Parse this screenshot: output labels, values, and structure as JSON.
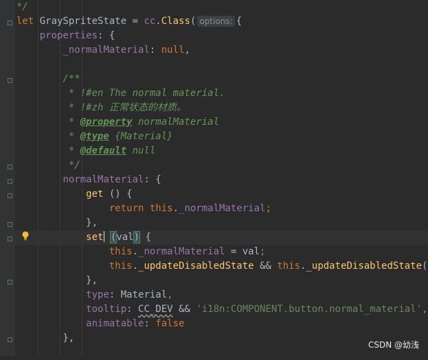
{
  "editor": {
    "lines": [
      {
        "segments": [
          {
            "t": "*/",
            "c": "com"
          }
        ]
      },
      {
        "segments": [
          {
            "t": "let ",
            "c": "kw"
          },
          {
            "t": "GraySpriteState = "
          },
          {
            "t": "cc",
            "c": "prop"
          },
          {
            "t": "."
          },
          {
            "t": "Class",
            "c": "fn"
          },
          {
            "t": "("
          },
          {
            "t": "options:",
            "c": "hint"
          },
          {
            "t": "{"
          }
        ]
      },
      {
        "segments": [
          {
            "t": "    "
          },
          {
            "t": "properties",
            "c": "prop"
          },
          {
            "t": ": {"
          }
        ]
      },
      {
        "segments": [
          {
            "t": "        "
          },
          {
            "t": "_normalMaterial",
            "c": "prop"
          },
          {
            "t": ": "
          },
          {
            "t": "null",
            "c": "kw"
          },
          {
            "t": ","
          }
        ]
      },
      {
        "segments": [
          {
            "t": ""
          }
        ]
      },
      {
        "segments": [
          {
            "t": "        /**",
            "c": "com"
          }
        ]
      },
      {
        "segments": [
          {
            "t": "         * !#en The normal material.",
            "c": "com"
          }
        ]
      },
      {
        "segments": [
          {
            "t": "         * !#zh 正常状态的材质。",
            "c": "com"
          }
        ]
      },
      {
        "segments": [
          {
            "t": "         * ",
            "c": "com"
          },
          {
            "t": "@property",
            "c": "tag"
          },
          {
            "t": " normalMaterial",
            "c": "com"
          }
        ]
      },
      {
        "segments": [
          {
            "t": "         * ",
            "c": "com"
          },
          {
            "t": "@type",
            "c": "tag"
          },
          {
            "t": " {Material}",
            "c": "com"
          }
        ]
      },
      {
        "segments": [
          {
            "t": "         * ",
            "c": "com"
          },
          {
            "t": "@default",
            "c": "tag"
          },
          {
            "t": " null",
            "c": "com"
          }
        ]
      },
      {
        "segments": [
          {
            "t": "         */",
            "c": "com"
          }
        ]
      },
      {
        "segments": [
          {
            "t": "        "
          },
          {
            "t": "normalMaterial",
            "c": "prop"
          },
          {
            "t": ": {"
          }
        ]
      },
      {
        "segments": [
          {
            "t": "            "
          },
          {
            "t": "get",
            "c": "fn"
          },
          {
            "t": " () {"
          }
        ]
      },
      {
        "segments": [
          {
            "t": "                "
          },
          {
            "t": "return this",
            "c": "kw"
          },
          {
            "t": "."
          },
          {
            "t": "_normalMaterial",
            "c": "prop"
          },
          {
            "t": ";",
            "c": "kw"
          }
        ]
      },
      {
        "segments": [
          {
            "t": "            },"
          }
        ]
      },
      {
        "current": true,
        "segments": [
          {
            "t": "            "
          },
          {
            "t": "set",
            "c": "fn"
          },
          {
            "t": "",
            "c": "caret"
          },
          {
            "t": " "
          },
          {
            "t": "(",
            "c": "match"
          },
          {
            "t": "val"
          },
          {
            "t": ")",
            "c": "match"
          },
          {
            "t": " {"
          }
        ]
      },
      {
        "segments": [
          {
            "t": "                "
          },
          {
            "t": "this",
            "c": "kw"
          },
          {
            "t": "."
          },
          {
            "t": "_normalMaterial",
            "c": "prop"
          },
          {
            "t": " = val"
          },
          {
            "t": ";",
            "c": "kw"
          }
        ]
      },
      {
        "segments": [
          {
            "t": "                "
          },
          {
            "t": "this",
            "c": "kw"
          },
          {
            "t": "."
          },
          {
            "t": "_updateDisabledState",
            "c": "fn"
          },
          {
            "t": " && "
          },
          {
            "t": "this",
            "c": "kw"
          },
          {
            "t": "."
          },
          {
            "t": "_updateDisabledState",
            "c": "fn"
          },
          {
            "t": "()"
          },
          {
            "t": ";",
            "c": "kw"
          }
        ]
      },
      {
        "segments": [
          {
            "t": "            },"
          }
        ]
      },
      {
        "segments": [
          {
            "t": "            "
          },
          {
            "t": "type",
            "c": "prop"
          },
          {
            "t": ": Material"
          },
          {
            "t": ",",
            "c": "kw"
          }
        ]
      },
      {
        "segments": [
          {
            "t": "            "
          },
          {
            "t": "tooltip",
            "c": "prop"
          },
          {
            "t": ": "
          },
          {
            "t": "CC_DEV",
            "c": "squiggle"
          },
          {
            "t": " && "
          },
          {
            "t": "'i18n:COMPONENT.button.normal_material'",
            "c": "str"
          },
          {
            "t": ",",
            "c": "kw"
          }
        ]
      },
      {
        "segments": [
          {
            "t": "            "
          },
          {
            "t": "animatable",
            "c": "prop"
          },
          {
            "t": ": "
          },
          {
            "t": "false",
            "c": "kw"
          }
        ]
      },
      {
        "segments": [
          {
            "t": "        },"
          }
        ]
      },
      {
        "segments": [
          {
            "t": ""
          }
        ]
      }
    ]
  },
  "watermark": "CSDN @幼浅"
}
